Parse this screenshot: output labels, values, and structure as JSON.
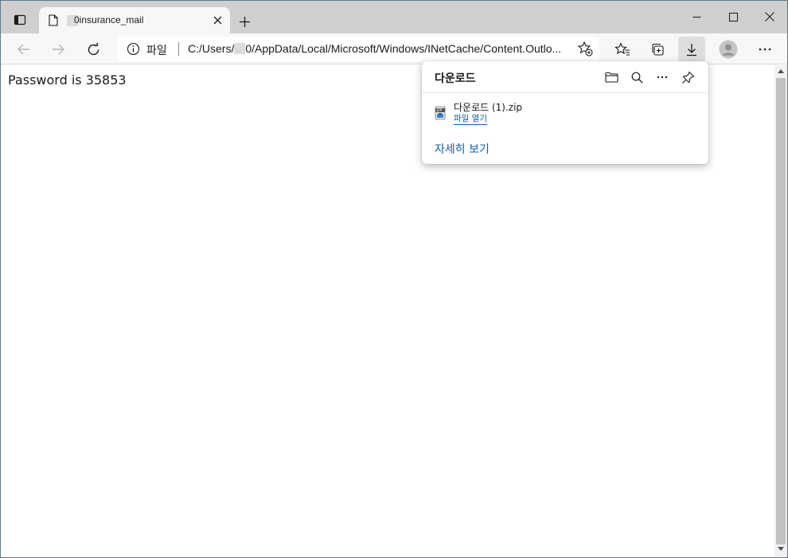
{
  "tab": {
    "title": "0insurance_mail"
  },
  "toolbar": {
    "scheme_label": "파일",
    "url_prefix": "C:/Users/",
    "url_suffix": "0/AppData/Local/Microsoft/Windows/INetCache/Content.Outlo..."
  },
  "content": {
    "message": "Password is 35853"
  },
  "downloads": {
    "heading": "다운로드",
    "item": {
      "file_name": "다운로드 (1).zip",
      "open_label": "파일 열기"
    },
    "more_label": "자세히 보기"
  },
  "icons": {
    "tab_actions": "tab-actions-icon",
    "page": "page-icon",
    "close": "close-icon",
    "new_tab": "plus-icon",
    "minimize": "minimize-icon",
    "maximize": "maximize-icon",
    "window_close": "window-close-icon",
    "back": "back-arrow-icon",
    "forward": "forward-arrow-icon",
    "refresh": "refresh-icon",
    "info": "info-icon",
    "add_favorite": "add-favorite-icon",
    "favorites": "favorites-icon",
    "collections": "collections-icon",
    "download": "download-icon",
    "profile": "profile-icon",
    "menu": "more-dots-icon",
    "folder": "folder-icon",
    "search": "search-icon",
    "pin": "pin-icon",
    "zip": "zip-file-icon"
  },
  "colors": {
    "link": "#0a5fb4",
    "tabstrip": "#cfcfcf",
    "toolbar": "#f7f7f7"
  }
}
